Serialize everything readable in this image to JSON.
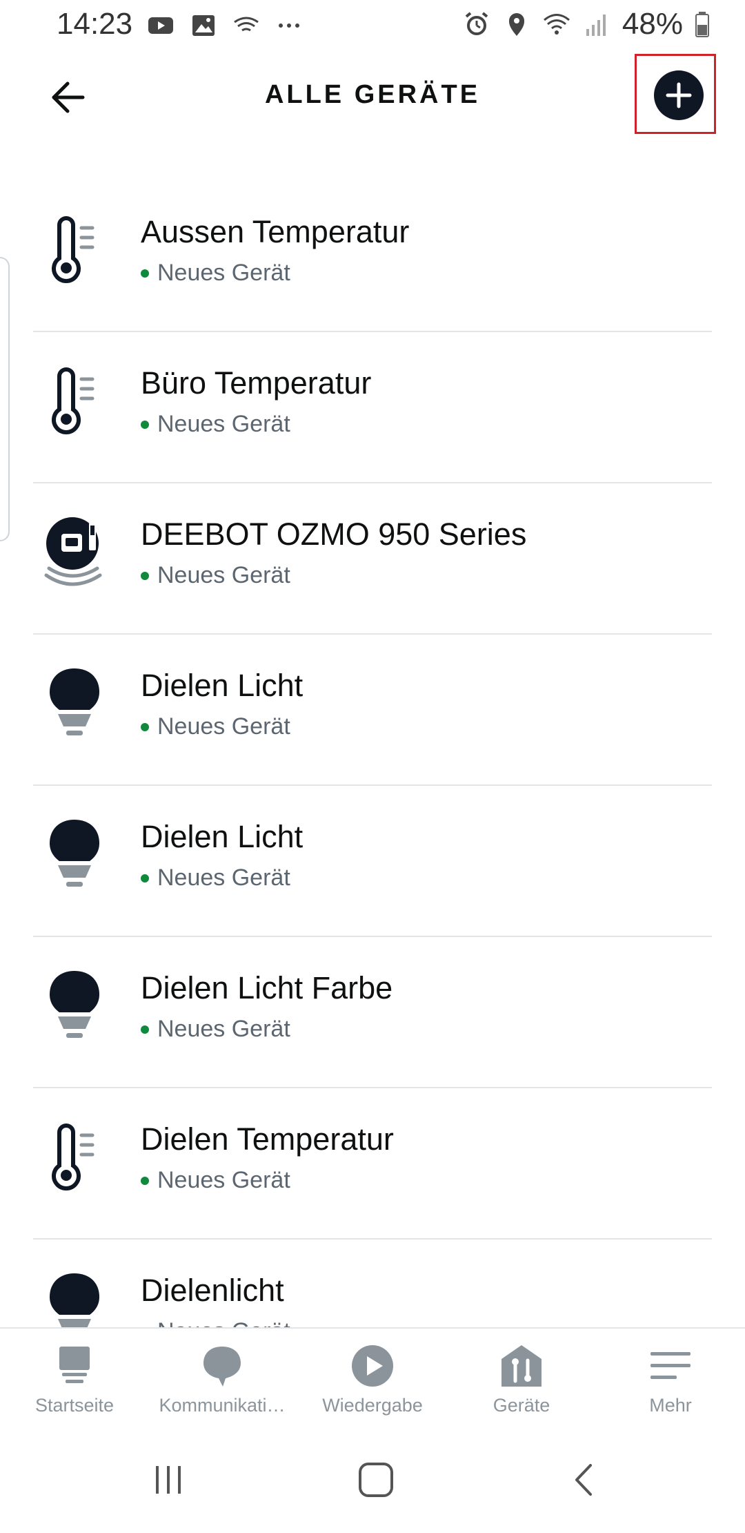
{
  "status_bar": {
    "time": "14:23",
    "battery": "48%",
    "left_icons": [
      "youtube-icon",
      "image-icon",
      "wifi-calling-icon",
      "more-icon"
    ],
    "right_icons": [
      "alarm-icon",
      "location-icon",
      "wifi-icon",
      "signal-icon",
      "battery-icon"
    ]
  },
  "header": {
    "title": "ALLE GERÄTE",
    "back_icon": "arrow-left-icon",
    "add_icon": "plus-circle-icon"
  },
  "devices": [
    {
      "name": "Aussen Temperatur",
      "status": "Neues Gerät",
      "icon": "thermometer-icon"
    },
    {
      "name": "Büro Temperatur",
      "status": "Neues Gerät",
      "icon": "thermometer-icon"
    },
    {
      "name": "DEEBOT OZMO 950 Series",
      "status": "Neues Gerät",
      "icon": "robot-vacuum-icon"
    },
    {
      "name": "Dielen Licht",
      "status": "Neues Gerät",
      "icon": "lightbulb-icon"
    },
    {
      "name": "Dielen Licht",
      "status": "Neues Gerät",
      "icon": "lightbulb-icon"
    },
    {
      "name": "Dielen Licht Farbe",
      "status": "Neues Gerät",
      "icon": "lightbulb-icon"
    },
    {
      "name": "Dielen Temperatur",
      "status": "Neues Gerät",
      "icon": "thermometer-icon"
    },
    {
      "name": "Dielenlicht",
      "status": "Neues Gerät",
      "icon": "lightbulb-icon"
    }
  ],
  "bottom_nav": [
    {
      "label": "Startseite",
      "icon": "home-icon"
    },
    {
      "label": "Kommunikati…",
      "icon": "chat-bubble-icon"
    },
    {
      "label": "Wiedergabe",
      "icon": "play-icon"
    },
    {
      "label": "Geräte",
      "icon": "devices-icon"
    },
    {
      "label": "Mehr",
      "icon": "menu-icon"
    }
  ],
  "colors": {
    "status_online": "#0f8a3d",
    "nav_inactive": "#8c949b",
    "highlight_border": "#d0202a",
    "icon_dark": "#0f1724"
  }
}
